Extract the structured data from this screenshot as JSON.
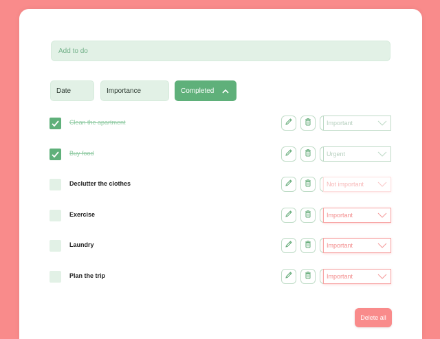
{
  "add": {
    "placeholder": "Add to do"
  },
  "filters": [
    {
      "label": "Date"
    },
    {
      "label": "Importance"
    },
    {
      "label": "Completed",
      "active": true
    }
  ],
  "todos": [
    {
      "text": "Clean the apartment",
      "done": true,
      "priority": "Important"
    },
    {
      "text": "Buy food",
      "done": true,
      "priority": "Urgent"
    },
    {
      "text": "Declutter the clothes",
      "done": false,
      "priority": "Not important"
    },
    {
      "text": "Exercise",
      "done": false,
      "priority": "Important"
    },
    {
      "text": "Laundry",
      "done": false,
      "priority": "Important"
    },
    {
      "text": "Plan the trip",
      "done": false,
      "priority": "Important"
    }
  ],
  "actions": {
    "delete_all": "Delete all"
  },
  "colors": {
    "accent_green": "#5fb07a",
    "light_green": "#e2f1e6",
    "coral": "#f98b8b"
  },
  "icons": [
    "pencil-icon",
    "trash-icon",
    "calendar-icon",
    "chevron-down-icon",
    "chevron-up-icon",
    "check-icon"
  ]
}
